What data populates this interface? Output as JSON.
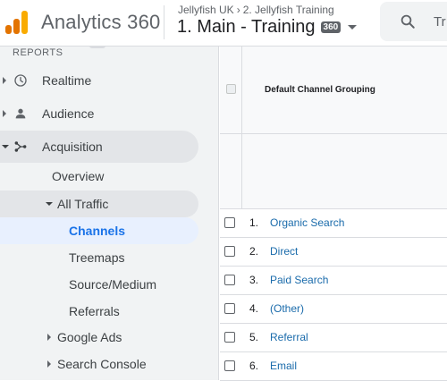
{
  "header": {
    "app_name": "Analytics 360",
    "breadcrumb": {
      "account": "Jellyfish UK",
      "property": "2. Jellyfish Training"
    },
    "view_name": "1. Main - Training",
    "view_badge": "360",
    "search_placeholder": "Tr"
  },
  "sidebar": {
    "section_label": "REPORTS",
    "items": [
      {
        "label": "Realtime",
        "icon": "clock-icon"
      },
      {
        "label": "Audience",
        "icon": "person-icon"
      },
      {
        "label": "Acquisition",
        "icon": "acquisition-icon",
        "expanded": true
      },
      {
        "label": "Overview"
      },
      {
        "label": "All Traffic",
        "expanded": true
      },
      {
        "label": "Channels",
        "active": true
      },
      {
        "label": "Treemaps"
      },
      {
        "label": "Source/Medium"
      },
      {
        "label": "Referrals"
      },
      {
        "label": "Google Ads"
      },
      {
        "label": "Search Console"
      }
    ]
  },
  "table": {
    "column_header": "Default Channel Grouping",
    "rows": [
      {
        "index": "1.",
        "channel": "Organic Search"
      },
      {
        "index": "2.",
        "channel": "Direct"
      },
      {
        "index": "3.",
        "channel": "Paid Search"
      },
      {
        "index": "4.",
        "channel": "(Other)"
      },
      {
        "index": "5.",
        "channel": "Referral"
      },
      {
        "index": "6.",
        "channel": "Email"
      }
    ]
  },
  "colors": {
    "brand_orange": "#e37400",
    "brand_yellow": "#f9ab00",
    "link_blue": "#1a6bab",
    "active_blue": "#1a73e8"
  }
}
